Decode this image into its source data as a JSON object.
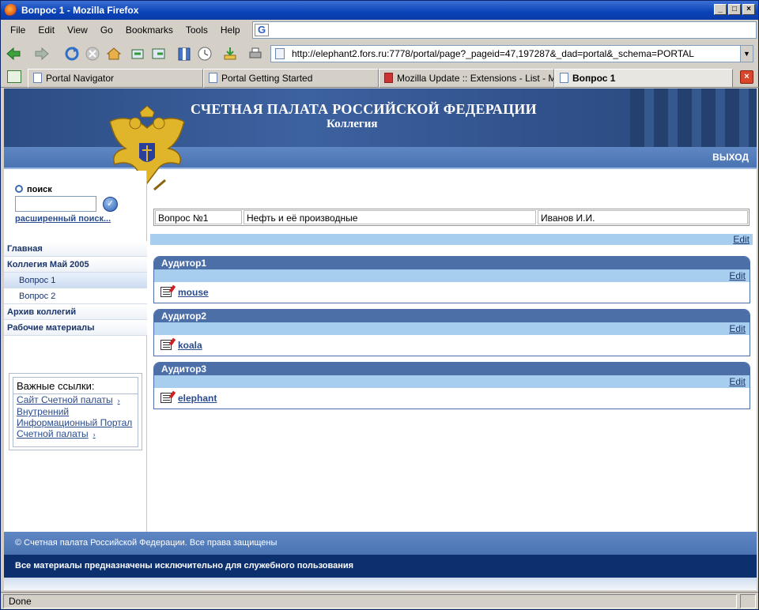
{
  "window": {
    "title": "Вопрос 1 - Mozilla Firefox"
  },
  "menu": {
    "items": [
      "File",
      "Edit",
      "View",
      "Go",
      "Bookmarks",
      "Tools",
      "Help"
    ]
  },
  "address": {
    "url": "http://elephant2.fors.ru:7778/portal/page?_pageid=47,197287&_dad=portal&_schema=PORTAL"
  },
  "tabs": [
    {
      "label": "Portal Navigator"
    },
    {
      "label": "Portal Getting Started"
    },
    {
      "label": "Mozilla Update :: Extensions - List - Mi..."
    },
    {
      "label": "Вопрос 1"
    }
  ],
  "header": {
    "title": "СЧЕТНАЯ ПАЛАТА РОССИЙСКОЙ ФЕДЕРАЦИИ",
    "subtitle": "Коллегия",
    "exit_label": "ВЫХОД"
  },
  "search": {
    "label": "поиск",
    "value": "",
    "advanced_label": "расширенный поиск..."
  },
  "nav": {
    "items": [
      {
        "label": "Главная",
        "level": 1
      },
      {
        "label": "Коллегия Май 2005",
        "level": 1
      },
      {
        "label": "Вопрос 1",
        "level": 2,
        "selected": true
      },
      {
        "label": "Вопрос 2",
        "level": 2
      },
      {
        "label": "Архив коллегий",
        "level": 1
      },
      {
        "label": "Рабочие материалы",
        "level": 1
      }
    ]
  },
  "links": {
    "title": "Важные ссылки:",
    "items": [
      {
        "label": "Сайт Счетной палаты"
      },
      {
        "label": "Внутренний"
      },
      {
        "label": "Информационный Портал"
      },
      {
        "label": "Счетной палаты"
      }
    ]
  },
  "question": {
    "number": "Вопрос №1",
    "topic": "Нефть и её производные",
    "person": "Иванов И.И.",
    "edit_label": "Edit"
  },
  "auditors": [
    {
      "title": "Аудитор1",
      "edit_label": "Edit",
      "item": "mouse"
    },
    {
      "title": "Аудитор2",
      "edit_label": "Edit",
      "item": "koala"
    },
    {
      "title": "Аудитор3",
      "edit_label": "Edit",
      "item": "elephant"
    }
  ],
  "footer": {
    "copyright": "© Счетная палата Российской Федерации. Все права защищены",
    "notice": "Все материалы предназначены исключительно для служебного пользования"
  },
  "status": {
    "text": "Done"
  },
  "colors": {
    "banner": "#3d62a0",
    "panel_header": "#4d6fa8",
    "strip": "#a7ceef",
    "footer_dark": "#0c2f6e"
  }
}
